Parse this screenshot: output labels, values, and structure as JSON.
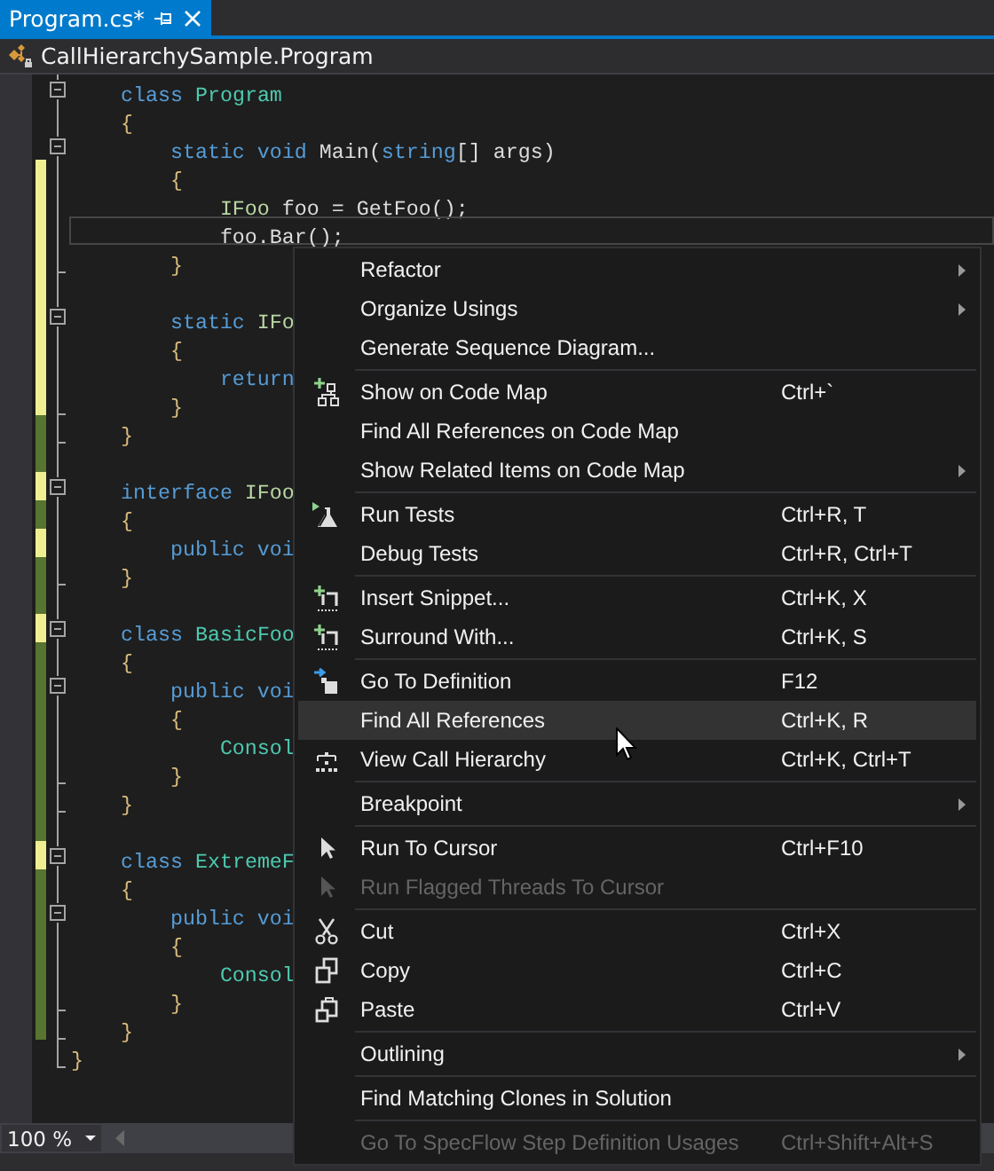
{
  "tab": {
    "title": "Program.cs*",
    "selected": true
  },
  "navbar": {
    "type_name": "CallHierarchySample.Program"
  },
  "editor": {
    "lines": [
      {
        "fold_start": true,
        "fold_end": false,
        "changed": false,
        "current": false,
        "tokens": [
          {
            "kind": "keyword",
            "text": "    class"
          },
          {
            "kind": "type",
            "text": " Program"
          }
        ]
      },
      {
        "fold_start": false,
        "fold_end": false,
        "changed": false,
        "current": false,
        "tokens": [
          {
            "kind": "brace",
            "text": "    {"
          }
        ]
      },
      {
        "fold_start": true,
        "fold_end": false,
        "changed": false,
        "current": false,
        "tokens": [
          {
            "kind": "keyword",
            "text": "        static void"
          },
          {
            "kind": "plain",
            "text": " Main("
          },
          {
            "kind": "keyword",
            "text": "string"
          },
          {
            "kind": "plain",
            "text": "[] args)"
          }
        ]
      },
      {
        "fold_start": false,
        "fold_end": false,
        "changed": true,
        "saved": false,
        "current": false,
        "tokens": [
          {
            "kind": "brace",
            "text": "        {"
          }
        ]
      },
      {
        "fold_start": false,
        "fold_end": false,
        "changed": true,
        "saved": false,
        "current": false,
        "tokens": [
          {
            "kind": "interface",
            "text": "            IFoo"
          },
          {
            "kind": "plain",
            "text": " foo = GetFoo();"
          }
        ]
      },
      {
        "fold_start": false,
        "fold_end": false,
        "changed": true,
        "saved": false,
        "current": true,
        "tokens": [
          {
            "kind": "plain",
            "text": "            foo.Bar();"
          }
        ]
      },
      {
        "fold_start": false,
        "fold_end": true,
        "changed": true,
        "saved": false,
        "current": false,
        "tokens": [
          {
            "kind": "brace",
            "text": "        }"
          }
        ]
      },
      {
        "fold_start": false,
        "fold_end": false,
        "changed": true,
        "saved": false,
        "current": false
      },
      {
        "fold_start": true,
        "fold_end": false,
        "changed": true,
        "saved": false,
        "current": false,
        "tokens": [
          {
            "kind": "keyword",
            "text": "        static"
          },
          {
            "kind": "interface",
            "text": " IFo"
          }
        ]
      },
      {
        "fold_start": false,
        "fold_end": false,
        "changed": true,
        "saved": false,
        "current": false,
        "tokens": [
          {
            "kind": "brace",
            "text": "        {"
          }
        ]
      },
      {
        "fold_start": false,
        "fold_end": false,
        "changed": true,
        "saved": false,
        "current": false,
        "tokens": [
          {
            "kind": "keyword",
            "text": "            return"
          }
        ]
      },
      {
        "fold_start": false,
        "fold_end": true,
        "changed": true,
        "saved": false,
        "current": false,
        "tokens": [
          {
            "kind": "brace",
            "text": "        }"
          }
        ]
      },
      {
        "fold_start": false,
        "fold_end": true,
        "changed": true,
        "saved": true,
        "current": false,
        "tokens": [
          {
            "kind": "brace",
            "text": "    }"
          }
        ]
      },
      {
        "fold_start": false,
        "fold_end": false,
        "changed": true,
        "saved": true,
        "current": false
      },
      {
        "fold_start": true,
        "fold_end": false,
        "changed": true,
        "saved": false,
        "current": false,
        "tokens": [
          {
            "kind": "keyword",
            "text": "    interface"
          },
          {
            "kind": "interface",
            "text": " IFoo"
          }
        ]
      },
      {
        "fold_start": false,
        "fold_end": false,
        "changed": true,
        "saved": true,
        "current": false,
        "tokens": [
          {
            "kind": "brace",
            "text": "    {"
          }
        ]
      },
      {
        "fold_start": false,
        "fold_end": false,
        "changed": true,
        "saved": false,
        "current": false,
        "tokens": [
          {
            "kind": "keyword",
            "text": "        public voi"
          }
        ]
      },
      {
        "fold_start": false,
        "fold_end": true,
        "changed": true,
        "saved": true,
        "current": false,
        "tokens": [
          {
            "kind": "brace",
            "text": "    }"
          }
        ]
      },
      {
        "fold_start": false,
        "fold_end": false,
        "changed": true,
        "saved": true,
        "current": false
      },
      {
        "fold_start": true,
        "fold_end": false,
        "changed": true,
        "saved": false,
        "current": false,
        "tokens": [
          {
            "kind": "keyword",
            "text": "    class"
          },
          {
            "kind": "type",
            "text": " BasicFoo"
          }
        ]
      },
      {
        "fold_start": false,
        "fold_end": false,
        "changed": true,
        "saved": true,
        "current": false,
        "tokens": [
          {
            "kind": "brace",
            "text": "    {"
          }
        ]
      },
      {
        "fold_start": true,
        "fold_end": false,
        "changed": true,
        "saved": true,
        "current": false,
        "tokens": [
          {
            "kind": "keyword",
            "text": "        public voi"
          }
        ]
      },
      {
        "fold_start": false,
        "fold_end": false,
        "changed": true,
        "saved": true,
        "current": false,
        "tokens": [
          {
            "kind": "brace",
            "text": "        {"
          }
        ]
      },
      {
        "fold_start": false,
        "fold_end": false,
        "changed": true,
        "saved": true,
        "current": false,
        "tokens": [
          {
            "kind": "type",
            "text": "            Consol"
          }
        ]
      },
      {
        "fold_start": false,
        "fold_end": true,
        "changed": true,
        "saved": true,
        "current": false,
        "tokens": [
          {
            "kind": "brace",
            "text": "        }"
          }
        ]
      },
      {
        "fold_start": false,
        "fold_end": true,
        "changed": true,
        "saved": true,
        "current": false,
        "tokens": [
          {
            "kind": "brace",
            "text": "    }"
          }
        ]
      },
      {
        "fold_start": false,
        "fold_end": false,
        "changed": true,
        "saved": true,
        "current": false
      },
      {
        "fold_start": true,
        "fold_end": false,
        "changed": true,
        "saved": false,
        "current": false,
        "tokens": [
          {
            "kind": "keyword",
            "text": "    class"
          },
          {
            "kind": "type",
            "text": " ExtremeF"
          }
        ]
      },
      {
        "fold_start": false,
        "fold_end": false,
        "changed": true,
        "saved": true,
        "current": false,
        "tokens": [
          {
            "kind": "brace",
            "text": "    {"
          }
        ]
      },
      {
        "fold_start": true,
        "fold_end": false,
        "changed": true,
        "saved": true,
        "current": false,
        "tokens": [
          {
            "kind": "keyword",
            "text": "        public voi"
          }
        ]
      },
      {
        "fold_start": false,
        "fold_end": false,
        "changed": true,
        "saved": true,
        "current": false,
        "tokens": [
          {
            "kind": "brace",
            "text": "        {"
          }
        ]
      },
      {
        "fold_start": false,
        "fold_end": false,
        "changed": true,
        "saved": true,
        "current": false,
        "tokens": [
          {
            "kind": "type",
            "text": "            Consol"
          }
        ]
      },
      {
        "fold_start": false,
        "fold_end": true,
        "changed": true,
        "saved": true,
        "current": false,
        "tokens": [
          {
            "kind": "brace",
            "text": "        }"
          }
        ]
      },
      {
        "fold_start": false,
        "fold_end": true,
        "changed": true,
        "saved": true,
        "current": false,
        "tokens": [
          {
            "kind": "brace",
            "text": "    }"
          }
        ]
      },
      {
        "fold_start": false,
        "fold_end": true,
        "changed": false,
        "current": false,
        "tokens": [
          {
            "kind": "brace",
            "text": "}"
          }
        ]
      }
    ]
  },
  "context_menu": {
    "items": [
      {
        "kind": "item",
        "label": "Refactor",
        "submenu": true,
        "disabled": false,
        "highlighted": false
      },
      {
        "kind": "item",
        "label": "Organize Usings",
        "submenu": true,
        "disabled": false,
        "highlighted": false
      },
      {
        "kind": "item",
        "label": "Generate Sequence Diagram...",
        "submenu": false,
        "disabled": false,
        "highlighted": false
      },
      {
        "kind": "separator"
      },
      {
        "kind": "item",
        "label": "Show on Code Map",
        "shortcut": "Ctrl+`",
        "submenu": false,
        "disabled": false,
        "highlighted": false
      },
      {
        "kind": "item",
        "label": "Find All References on Code Map",
        "submenu": false,
        "disabled": false,
        "highlighted": false
      },
      {
        "kind": "item",
        "label": "Show Related Items on Code Map",
        "submenu": true,
        "disabled": false,
        "highlighted": false
      },
      {
        "kind": "separator"
      },
      {
        "kind": "item",
        "label": "Run Tests",
        "shortcut": "Ctrl+R, T",
        "submenu": false,
        "disabled": false,
        "highlighted": false
      },
      {
        "kind": "item",
        "label": "Debug Tests",
        "shortcut": "Ctrl+R, Ctrl+T",
        "submenu": false,
        "disabled": false,
        "highlighted": false
      },
      {
        "kind": "separator"
      },
      {
        "kind": "item",
        "label": "Insert Snippet...",
        "shortcut": "Ctrl+K, X",
        "submenu": false,
        "disabled": false,
        "highlighted": false
      },
      {
        "kind": "item",
        "label": "Surround With...",
        "shortcut": "Ctrl+K, S",
        "submenu": false,
        "disabled": false,
        "highlighted": false
      },
      {
        "kind": "separator"
      },
      {
        "kind": "item",
        "label": "Go To Definition",
        "shortcut": "F12",
        "submenu": false,
        "disabled": false,
        "highlighted": false
      },
      {
        "kind": "item",
        "label": "Find All References",
        "shortcut": "Ctrl+K, R",
        "submenu": false,
        "disabled": false,
        "highlighted": true
      },
      {
        "kind": "item",
        "label": "View Call Hierarchy",
        "shortcut": "Ctrl+K, Ctrl+T",
        "submenu": false,
        "disabled": false,
        "highlighted": false
      },
      {
        "kind": "separator"
      },
      {
        "kind": "item",
        "label": "Breakpoint",
        "submenu": true,
        "disabled": false,
        "highlighted": false
      },
      {
        "kind": "separator"
      },
      {
        "kind": "item",
        "label": "Run To Cursor",
        "shortcut": "Ctrl+F10",
        "submenu": false,
        "disabled": false,
        "highlighted": false
      },
      {
        "kind": "item",
        "label": "Run Flagged Threads To Cursor",
        "submenu": false,
        "disabled": true,
        "highlighted": false
      },
      {
        "kind": "separator"
      },
      {
        "kind": "item",
        "label": "Cut",
        "shortcut": "Ctrl+X",
        "submenu": false,
        "disabled": false,
        "highlighted": false
      },
      {
        "kind": "item",
        "label": "Copy",
        "shortcut": "Ctrl+C",
        "submenu": false,
        "disabled": false,
        "highlighted": false
      },
      {
        "kind": "item",
        "label": "Paste",
        "shortcut": "Ctrl+V",
        "submenu": false,
        "disabled": false,
        "highlighted": false
      },
      {
        "kind": "separator"
      },
      {
        "kind": "item",
        "label": "Outlining",
        "submenu": true,
        "disabled": false,
        "highlighted": false
      },
      {
        "kind": "separator"
      },
      {
        "kind": "item",
        "label": "Find Matching Clones in Solution",
        "submenu": false,
        "disabled": false,
        "highlighted": false
      },
      {
        "kind": "separator"
      },
      {
        "kind": "item",
        "label": "Go To SpecFlow Step Definition Usages",
        "shortcut": "Ctrl+Shift+Alt+S",
        "submenu": false,
        "disabled": true,
        "highlighted": false
      }
    ]
  },
  "status_bar": {
    "zoom": "100 %"
  }
}
